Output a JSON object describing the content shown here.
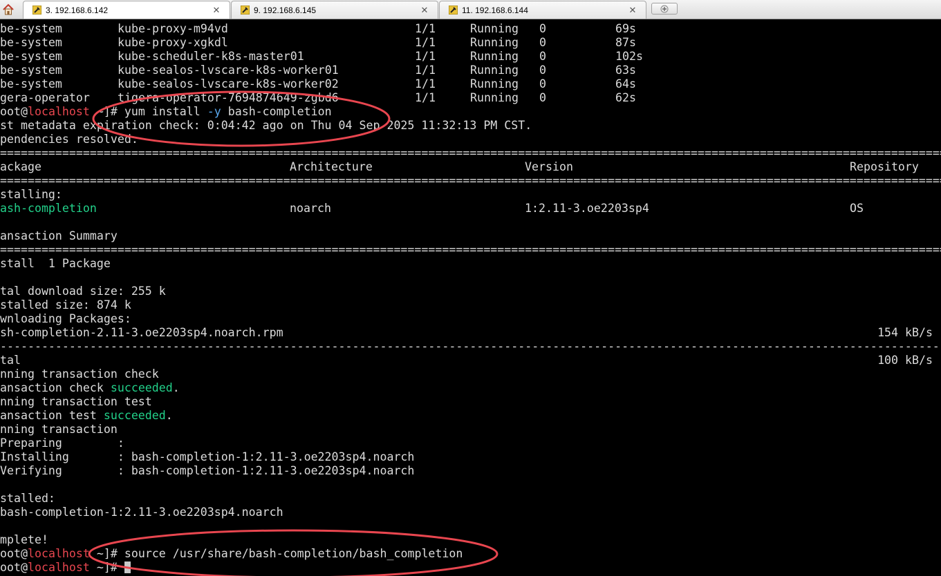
{
  "tabs": [
    {
      "label": "3. 192.168.6.142",
      "active": true
    },
    {
      "label": "9. 192.168.6.145",
      "active": false
    },
    {
      "label": "11. 192.168.6.144",
      "active": false
    }
  ],
  "tab_close_glyph": "✕",
  "icons": {
    "home": "home-icon",
    "tab": "terminal-key-icon",
    "new_tab": "new-tab-icon",
    "close": "close-icon"
  },
  "colors": {
    "prompt_host": "#e8464f",
    "flag": "#5aa9ef",
    "success": "#22d18a",
    "annotation": "#e8464f"
  },
  "pods": [
    {
      "ns": "be-system",
      "name": "kube-proxy-m94vd",
      "ready": "1/1",
      "status": "Running",
      "restarts": "0",
      "age": "69s"
    },
    {
      "ns": "be-system",
      "name": "kube-proxy-xgkdl",
      "ready": "1/1",
      "status": "Running",
      "restarts": "0",
      "age": "87s"
    },
    {
      "ns": "be-system",
      "name": "kube-scheduler-k8s-master01",
      "ready": "1/1",
      "status": "Running",
      "restarts": "0",
      "age": "102s"
    },
    {
      "ns": "be-system",
      "name": "kube-sealos-lvscare-k8s-worker01",
      "ready": "1/1",
      "status": "Running",
      "restarts": "0",
      "age": "63s"
    },
    {
      "ns": "be-system",
      "name": "kube-sealos-lvscare-k8s-worker02",
      "ready": "1/1",
      "status": "Running",
      "restarts": "0",
      "age": "64s"
    },
    {
      "ns": "gera-operator",
      "name": "tigera-operator-7694874649-zgbd6",
      "ready": "1/1",
      "status": "Running",
      "restarts": "0",
      "age": "62s"
    }
  ],
  "prompt": {
    "user_part": "oot",
    "at": "@",
    "host": "localhost",
    "dir": " ~]# "
  },
  "cmd1": {
    "pre": "yum install ",
    "flag": "-y",
    "post": " bash-completion"
  },
  "metadata_line": "st metadata expiration check: 0:04:42 ago on Thu 04 Sep 2025 11:32:13 PM CST.",
  "deps_line": "pendencies resolved.",
  "table_header": {
    "package": "ackage",
    "arch": "Architecture",
    "version": "Version",
    "repo": "Repository"
  },
  "installing_label": "stalling:",
  "pkg_row": {
    "name": "ash-completion",
    "arch": "noarch",
    "version": "1:2.11-3.oe2203sp4",
    "repo": "OS"
  },
  "txn_summary": "ansaction Summary",
  "install_count": "stall  1 Package",
  "download_size": "tal download size: 255 k",
  "installed_size": "stalled size: 874 k",
  "downloading": "wnloading Packages:",
  "rpm_line": {
    "file": "sh-completion-2.11-3.oe2203sp4.noarch.rpm",
    "speed": "154 kB/s"
  },
  "total_line": {
    "label": "tal",
    "speed": "100 kB/s"
  },
  "running_check": "nning transaction check",
  "check_done": {
    "pre": "ansaction check ",
    "ok": "succeeded",
    "post": "."
  },
  "running_test": "nning transaction test",
  "test_done": {
    "pre": "ansaction test ",
    "ok": "succeeded",
    "post": "."
  },
  "running_txn": "nning transaction",
  "preparing": "Preparing        :",
  "installing_step": "Installing       : bash-completion-1:2.11-3.oe2203sp4.noarch",
  "verifying_step": "Verifying        : bash-completion-1:2.11-3.oe2203sp4.noarch",
  "installed_label": "stalled:",
  "installed_pkg": "bash-completion-1:2.11-3.oe2203sp4.noarch",
  "complete": "mplete!",
  "cmd2": "source /usr/share/bash-completion/bash_completion"
}
